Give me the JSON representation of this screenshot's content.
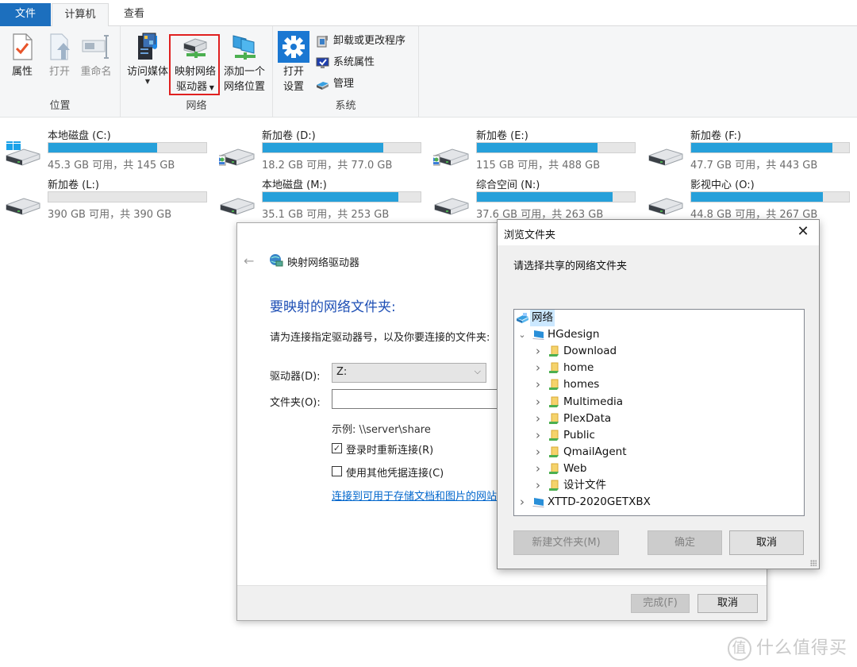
{
  "ribbon": {
    "tabs": [
      {
        "label": "文件",
        "active": false
      },
      {
        "label": "计算机",
        "active": true
      },
      {
        "label": "查看",
        "active": false
      }
    ],
    "groups": {
      "location": {
        "label": "位置",
        "buttons": [
          {
            "label": "属性",
            "icon": "properties-icon",
            "enabled": true
          },
          {
            "label": "打开",
            "icon": "open-icon",
            "enabled": false
          },
          {
            "label": "重命名",
            "icon": "rename-icon",
            "enabled": false
          }
        ]
      },
      "network": {
        "label": "网络",
        "buttons": [
          {
            "label": "访问媒体",
            "icon": "media-icon",
            "has_dropdown": true
          },
          {
            "label_line1": "映射网络",
            "label_line2": "驱动器",
            "icon": "map-network-drive-icon",
            "has_dropdown": true,
            "highlighted": true
          },
          {
            "label_line1": "添加一个",
            "label_line2": "网络位置",
            "icon": "add-network-location-icon"
          }
        ]
      },
      "system": {
        "label": "系统",
        "open_settings": {
          "label_line1": "打开",
          "label_line2": "设置",
          "icon": "gear-icon"
        },
        "commands": [
          {
            "label": "卸载或更改程序",
            "icon": "uninstall-icon"
          },
          {
            "label": "系统属性",
            "icon": "system-properties-icon"
          },
          {
            "label": "管理",
            "icon": "manage-icon"
          }
        ]
      }
    },
    "highlight_color": "#e02020"
  },
  "drives": [
    {
      "name": "本地磁盘 (C:)",
      "free_text": "45.3 GB 可用，共 145 GB",
      "used_fraction": 0.688,
      "os_drive": true,
      "shared": false
    },
    {
      "name": "新加卷 (D:)",
      "free_text": "18.2 GB 可用，共 77.0 GB",
      "used_fraction": 0.764,
      "os_drive": false,
      "shared": true
    },
    {
      "name": "新加卷 (E:)",
      "free_text": "115 GB 可用，共 488 GB",
      "used_fraction": 0.764,
      "os_drive": false,
      "shared": true
    },
    {
      "name": "新加卷 (F:)",
      "free_text": "47.7 GB 可用，共 443 GB",
      "used_fraction": 0.892,
      "os_drive": false,
      "shared": false
    },
    {
      "name": "新加卷 (L:)",
      "free_text": "390 GB 可用，共 390 GB",
      "used_fraction": 0.0,
      "os_drive": false,
      "shared": false
    },
    {
      "name": "本地磁盘 (M:)",
      "free_text": "35.1 GB 可用，共 253 GB",
      "used_fraction": 0.861,
      "os_drive": false,
      "shared": false
    },
    {
      "name": "综合空间 (N:)",
      "free_text": "37.6 GB 可用，共 263 GB",
      "used_fraction": 0.857,
      "os_drive": false,
      "shared": false
    },
    {
      "name": "影视中心 (O:)",
      "free_text": "44.8 GB 可用，共 267 GB",
      "used_fraction": 0.832,
      "os_drive": false,
      "shared": false
    }
  ],
  "drive_bar_color": "#26a0da",
  "wizard": {
    "title": "映射网络驱动器",
    "heading": "要映射的网络文件夹:",
    "description": "请为连接指定驱动器号，以及你要连接的文件夹:",
    "drive_label": "驱动器(D):",
    "drive_value": "Z:",
    "folder_label": "文件夹(O):",
    "folder_value": "",
    "example": "示例: \\\\server\\share",
    "reconnect_label": "登录时重新连接(R)",
    "reconnect_checked": true,
    "other_credentials_label": "使用其他凭据连接(C)",
    "other_credentials_checked": false,
    "link_text": "连接到可用于存储文档和图片的网站。",
    "finish_label": "完成(F)",
    "cancel_label": "取消",
    "heading_color": "#1e4fb5"
  },
  "browse": {
    "title": "浏览文件夹",
    "prompt": "请选择共享的网络文件夹",
    "tree": [
      {
        "label": "网络",
        "level": 0,
        "icon": "network-icon",
        "arrow": "",
        "selected": true
      },
      {
        "label": "HGdesign",
        "level": 1,
        "icon": "computer-icon",
        "arrow": "expanded",
        "selected": false
      },
      {
        "label": "Download",
        "level": 2,
        "icon": "shared-folder-icon",
        "arrow": "collapsed"
      },
      {
        "label": "home",
        "level": 2,
        "icon": "shared-folder-icon",
        "arrow": "collapsed"
      },
      {
        "label": "homes",
        "level": 2,
        "icon": "shared-folder-icon",
        "arrow": "collapsed"
      },
      {
        "label": "Multimedia",
        "level": 2,
        "icon": "shared-folder-icon",
        "arrow": "collapsed"
      },
      {
        "label": "PlexData",
        "level": 2,
        "icon": "shared-folder-icon",
        "arrow": "collapsed"
      },
      {
        "label": "Public",
        "level": 2,
        "icon": "shared-folder-icon",
        "arrow": "collapsed"
      },
      {
        "label": "QmailAgent",
        "level": 2,
        "icon": "shared-folder-icon",
        "arrow": "collapsed"
      },
      {
        "label": "Web",
        "level": 2,
        "icon": "shared-folder-icon",
        "arrow": "collapsed"
      },
      {
        "label": "设计文件",
        "level": 2,
        "icon": "shared-folder-icon",
        "arrow": "collapsed"
      },
      {
        "label": "XTTD-2020GETXBX",
        "level": 1,
        "icon": "computer-icon",
        "arrow": "collapsed"
      }
    ],
    "new_folder_label": "新建文件夹(M)",
    "ok_label": "确定",
    "cancel_label": "取消"
  },
  "watermark": {
    "glyph": "值",
    "text": "什么值得买"
  }
}
